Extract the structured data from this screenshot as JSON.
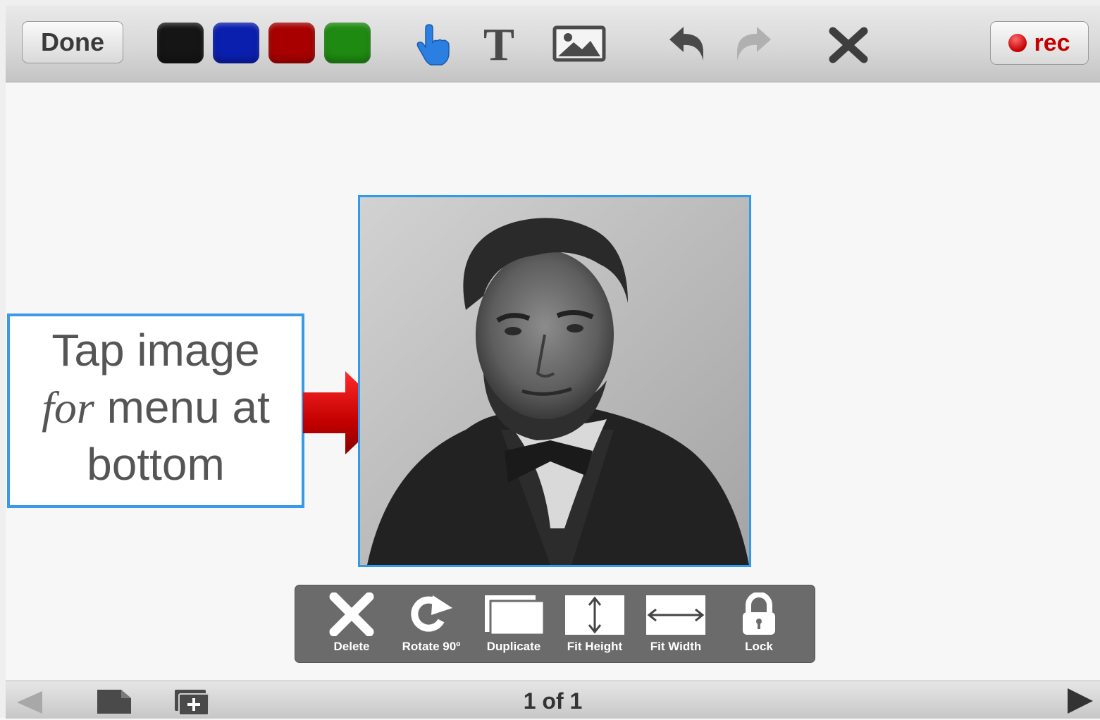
{
  "toolbar": {
    "done_label": "Done",
    "colors": [
      {
        "name": "black",
        "hex": "#151515"
      },
      {
        "name": "blue",
        "hex": "#0a1fae"
      },
      {
        "name": "red",
        "hex": "#a80000"
      },
      {
        "name": "green",
        "hex": "#1f8a12"
      }
    ],
    "tools": [
      "pointer-hand-icon",
      "text-tool-icon",
      "image-tool-icon",
      "undo-icon",
      "redo-icon",
      "clear-icon"
    ],
    "rec_label": "rec"
  },
  "callout": {
    "line1": "Tap image",
    "line2_italic": "for",
    "line2_rest": " menu at",
    "line3": "bottom"
  },
  "object_menu": {
    "items": [
      {
        "label": "Delete",
        "icon": "delete-x-icon"
      },
      {
        "label": "Rotate 90º",
        "icon": "rotate-icon"
      },
      {
        "label": "Duplicate",
        "icon": "duplicate-icon"
      },
      {
        "label": "Fit Height",
        "icon": "fit-height-icon"
      },
      {
        "label": "Fit Width",
        "icon": "fit-width-icon"
      },
      {
        "label": "Lock",
        "icon": "lock-icon"
      }
    ]
  },
  "bottombar": {
    "page_indicator": "1 of 1"
  },
  "accent_colors": {
    "selection": "#2f9be9",
    "arrow": "#c00000"
  }
}
